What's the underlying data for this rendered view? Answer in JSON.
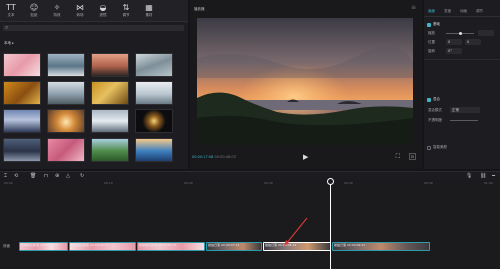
{
  "toolbar": {
    "items": [
      {
        "label": "文本",
        "icon": "text-icon",
        "glyph": "TT"
      },
      {
        "label": "贴纸",
        "icon": "sticker-icon",
        "glyph": "☺"
      },
      {
        "label": "特效",
        "icon": "effects-icon",
        "glyph": "✧"
      },
      {
        "label": "转场",
        "icon": "transition-icon",
        "glyph": "⋈"
      },
      {
        "label": "滤镜",
        "icon": "filter-icon",
        "glyph": "◒"
      },
      {
        "label": "调节",
        "icon": "adjust-icon",
        "glyph": "⇅"
      },
      {
        "label": "素材",
        "icon": "library-icon",
        "glyph": "▦"
      }
    ]
  },
  "media": {
    "tab_label": "本地 ▸",
    "thumbnails": [
      {
        "kind": "cherry"
      },
      {
        "kind": "seaside"
      },
      {
        "kind": "sunset"
      },
      {
        "kind": "waves"
      },
      {
        "kind": "autumn"
      },
      {
        "kind": "mountain-sky"
      },
      {
        "kind": "golden-tree"
      },
      {
        "kind": "clouds"
      },
      {
        "kind": "fuji"
      },
      {
        "kind": "bright-sky"
      },
      {
        "kind": "snow-peak"
      },
      {
        "kind": "fireworks"
      },
      {
        "kind": "city"
      },
      {
        "kind": "pink-forest"
      },
      {
        "kind": "green-field"
      },
      {
        "kind": "beach"
      }
    ]
  },
  "preview": {
    "title": "播放器",
    "current_time": "00:00:17:08",
    "total_time": "00:00:46:03"
  },
  "properties": {
    "tabs": [
      "画面",
      "变速",
      "动画",
      "调节"
    ],
    "sections": {
      "basic": "基础",
      "scale": "缩放",
      "position": "位置",
      "rotation": "旋转",
      "blend": "混合",
      "blend_mode": "混合模式",
      "opacity": "不透明度",
      "smart": "智能美颜"
    },
    "values": {
      "blend_mode": "正常",
      "position_x": "0",
      "position_y": "0",
      "rotation": "0°"
    }
  },
  "timeline": {
    "ticks": [
      "00:00",
      "00:10",
      "00:20",
      "00:30",
      "00:40",
      "00:50",
      "01:00"
    ],
    "track_label": "封面",
    "clips": [
      {
        "label": "粉嫩樱花飘落 00:00:07:09"
      },
      {
        "label": "粉嫩樱花飘落 00:00:08:11"
      },
      {
        "label": "粉嫩樱花飘落 00:00:06:13"
      },
      {
        "label": "航拍日落 00:00:07:14"
      },
      {
        "label": "航拍日落 00:00:08:19"
      },
      {
        "label": "航拍日落 00:00:09:21"
      }
    ]
  },
  "colors": {
    "accent": "#3fb6c8"
  }
}
